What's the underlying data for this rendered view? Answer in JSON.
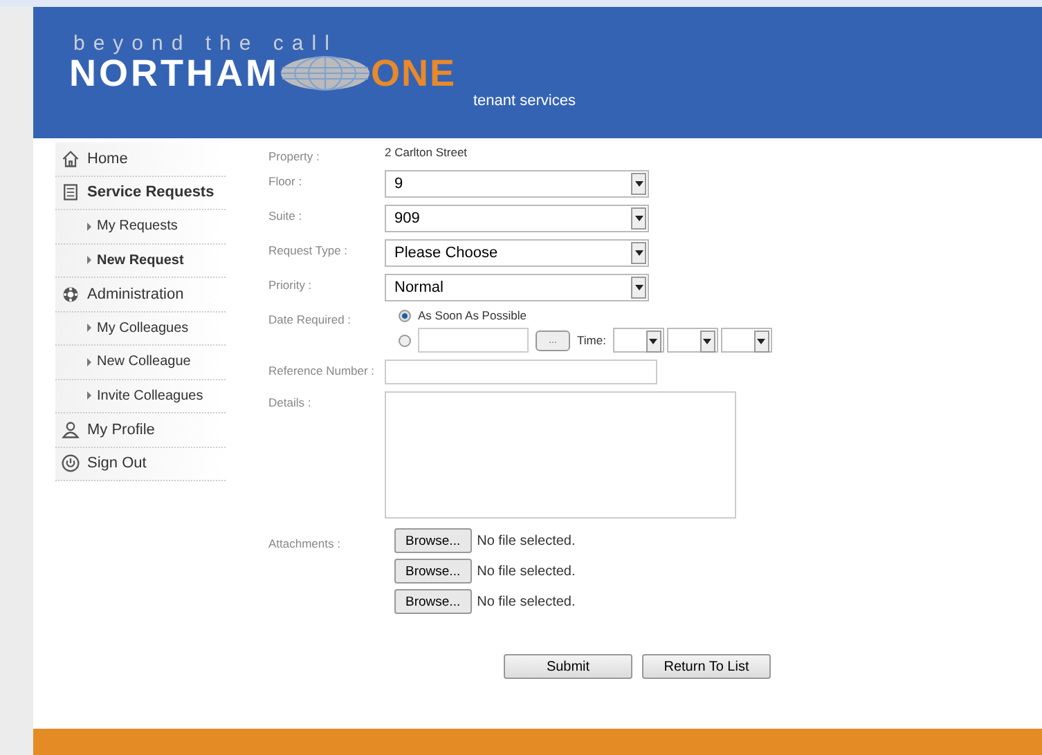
{
  "header": {
    "tagline": "beyond the call",
    "brand_left": "NORTHAM",
    "brand_right": "ONE",
    "subtitle": "tenant services"
  },
  "sidebar": {
    "items": [
      {
        "label": "Home",
        "kind": "top",
        "selected": false
      },
      {
        "label": "Service Requests",
        "kind": "top",
        "selected": true
      },
      {
        "label": "My Requests",
        "kind": "sub",
        "selected": false
      },
      {
        "label": "New Request",
        "kind": "sub",
        "selected": true
      },
      {
        "label": "Administration",
        "kind": "top",
        "selected": false
      },
      {
        "label": "My Colleagues",
        "kind": "sub",
        "selected": false
      },
      {
        "label": "New Colleague",
        "kind": "sub",
        "selected": false
      },
      {
        "label": "Invite Colleagues",
        "kind": "sub",
        "selected": false
      },
      {
        "label": "My Profile",
        "kind": "top",
        "selected": false
      },
      {
        "label": "Sign Out",
        "kind": "top",
        "selected": false
      }
    ]
  },
  "form": {
    "property": {
      "label": "Property :",
      "value": "2 Carlton Street"
    },
    "floor": {
      "label": "Floor :",
      "value": "9"
    },
    "suite": {
      "label": "Suite :",
      "value": "909"
    },
    "request_type": {
      "label": "Request Type :",
      "value": "Please Choose"
    },
    "priority": {
      "label": "Priority :",
      "value": "Normal"
    },
    "date_required": {
      "label": "Date Required :",
      "options": [
        {
          "label": "As Soon As Possible",
          "selected": true
        },
        {
          "selected": false,
          "picker_button": "...",
          "time_label": "Time:"
        }
      ]
    },
    "reference_number": {
      "label": "Reference Number :"
    },
    "details": {
      "label": "Details :"
    },
    "attachments": {
      "label": "Attachments :",
      "files": [
        {
          "button": "Browse...",
          "status": "No file selected."
        },
        {
          "button": "Browse...",
          "status": "No file selected."
        },
        {
          "button": "Browse...",
          "status": "No file selected."
        }
      ]
    }
  },
  "buttons": [
    "Submit",
    "Return To List"
  ]
}
